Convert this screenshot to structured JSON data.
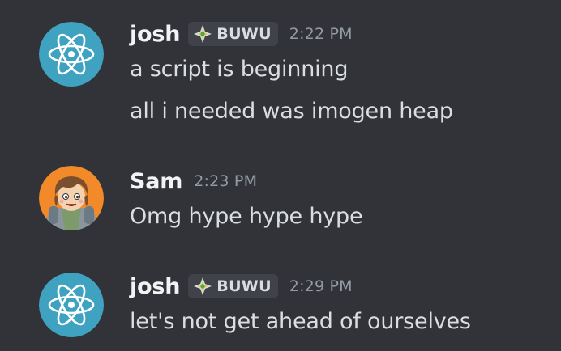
{
  "messages": [
    {
      "username": "josh",
      "tag": "BUWU",
      "timestamp": "2:22 PM",
      "avatar_icon": "atom-avatar",
      "lines": [
        "a script is beginning",
        "all i needed was imogen heap"
      ]
    },
    {
      "username": "Sam",
      "timestamp": "2:23 PM",
      "avatar_icon": "cartoon-character-avatar",
      "lines": [
        "Omg hype hype hype"
      ]
    },
    {
      "username": "josh",
      "tag": "BUWU",
      "timestamp": "2:29 PM",
      "avatar_icon": "atom-avatar",
      "lines": [
        "let's not get ahead of ourselves"
      ]
    }
  ],
  "colors": {
    "background": "#313338",
    "username": "#f2f3f5",
    "text": "#dbdee1",
    "timestamp": "#949ba4",
    "tag_background": "#404249",
    "atom_avatar": "#3fa2c0"
  }
}
